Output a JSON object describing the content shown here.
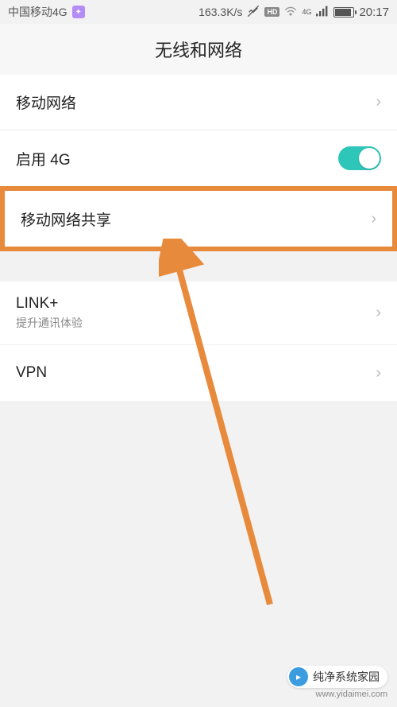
{
  "status": {
    "carrier": "中国移动4G",
    "speed": "163.3K/s",
    "hd": "HD",
    "net_label": "4G",
    "time": "20:17"
  },
  "header": {
    "title": "无线和网络"
  },
  "rows": {
    "mobile_network": {
      "label": "移动网络"
    },
    "enable_4g": {
      "label": "启用 4G"
    },
    "tethering": {
      "label": "移动网络共享"
    },
    "link_plus": {
      "label": "LINK+",
      "sub": "提升通讯体验"
    },
    "vpn": {
      "label": "VPN"
    }
  },
  "watermark": {
    "text": "纯净系统家园",
    "url": "www.yidaimei.com"
  }
}
